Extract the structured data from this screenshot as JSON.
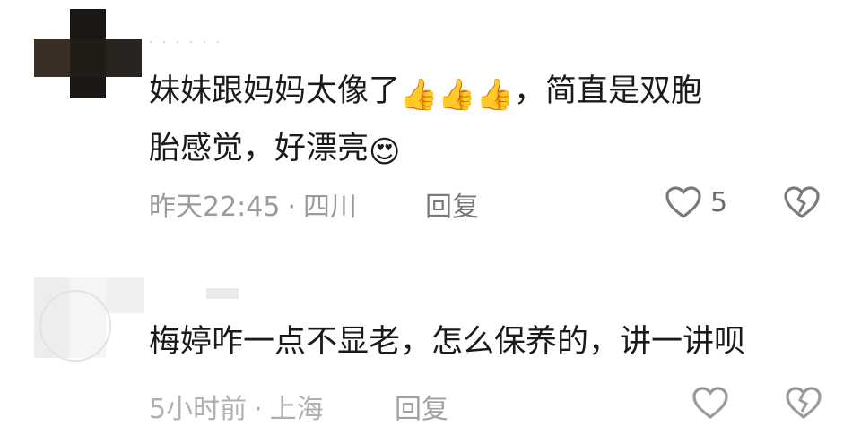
{
  "comments": [
    {
      "username": "· · · · · ·",
      "text_line1": "妹妹跟妈妈太像了",
      "text_line1_after": "，简直是双胞",
      "text_line2": "胎感觉，好漂亮",
      "emojis_inline": [
        "👍",
        "👍",
        "👍"
      ],
      "emoji_end": "😍",
      "time": "昨天22:45",
      "separator": "·",
      "location": "四川",
      "reply_label": "回复",
      "like_count": "5",
      "icons": {
        "like": "heart-outline-icon",
        "dislike": "broken-heart-icon"
      }
    },
    {
      "text": "梅婷咋一点不显老，怎么保养的，讲一讲呗",
      "time": "5小时前",
      "separator": "·",
      "location": "上海",
      "reply_label": "回复",
      "icons": {
        "like": "heart-outline-icon",
        "dislike": "broken-heart-icon"
      }
    }
  ],
  "colors": {
    "text": "#1a1a1a",
    "meta": "#9b9b9b",
    "icon": "#7a7a7a"
  }
}
